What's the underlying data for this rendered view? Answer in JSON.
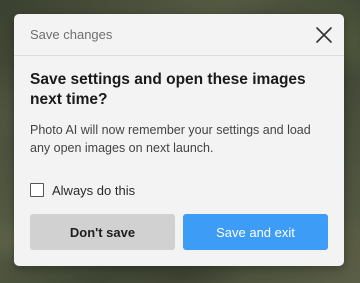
{
  "dialog": {
    "title": "Save changes",
    "heading": "Save settings and open these images next time?",
    "message": "Photo AI will now remember your settings and load any open images on next launch.",
    "checkbox": {
      "label": "Always do this",
      "checked": false
    },
    "buttons": {
      "secondary_label": "Don't save",
      "primary_label": "Save and exit"
    },
    "close_icon": "close-icon"
  },
  "colors": {
    "primary_button": "#3d9cf5",
    "secondary_button": "#d1d1d1",
    "dialog_background": "#f3f3f3"
  }
}
